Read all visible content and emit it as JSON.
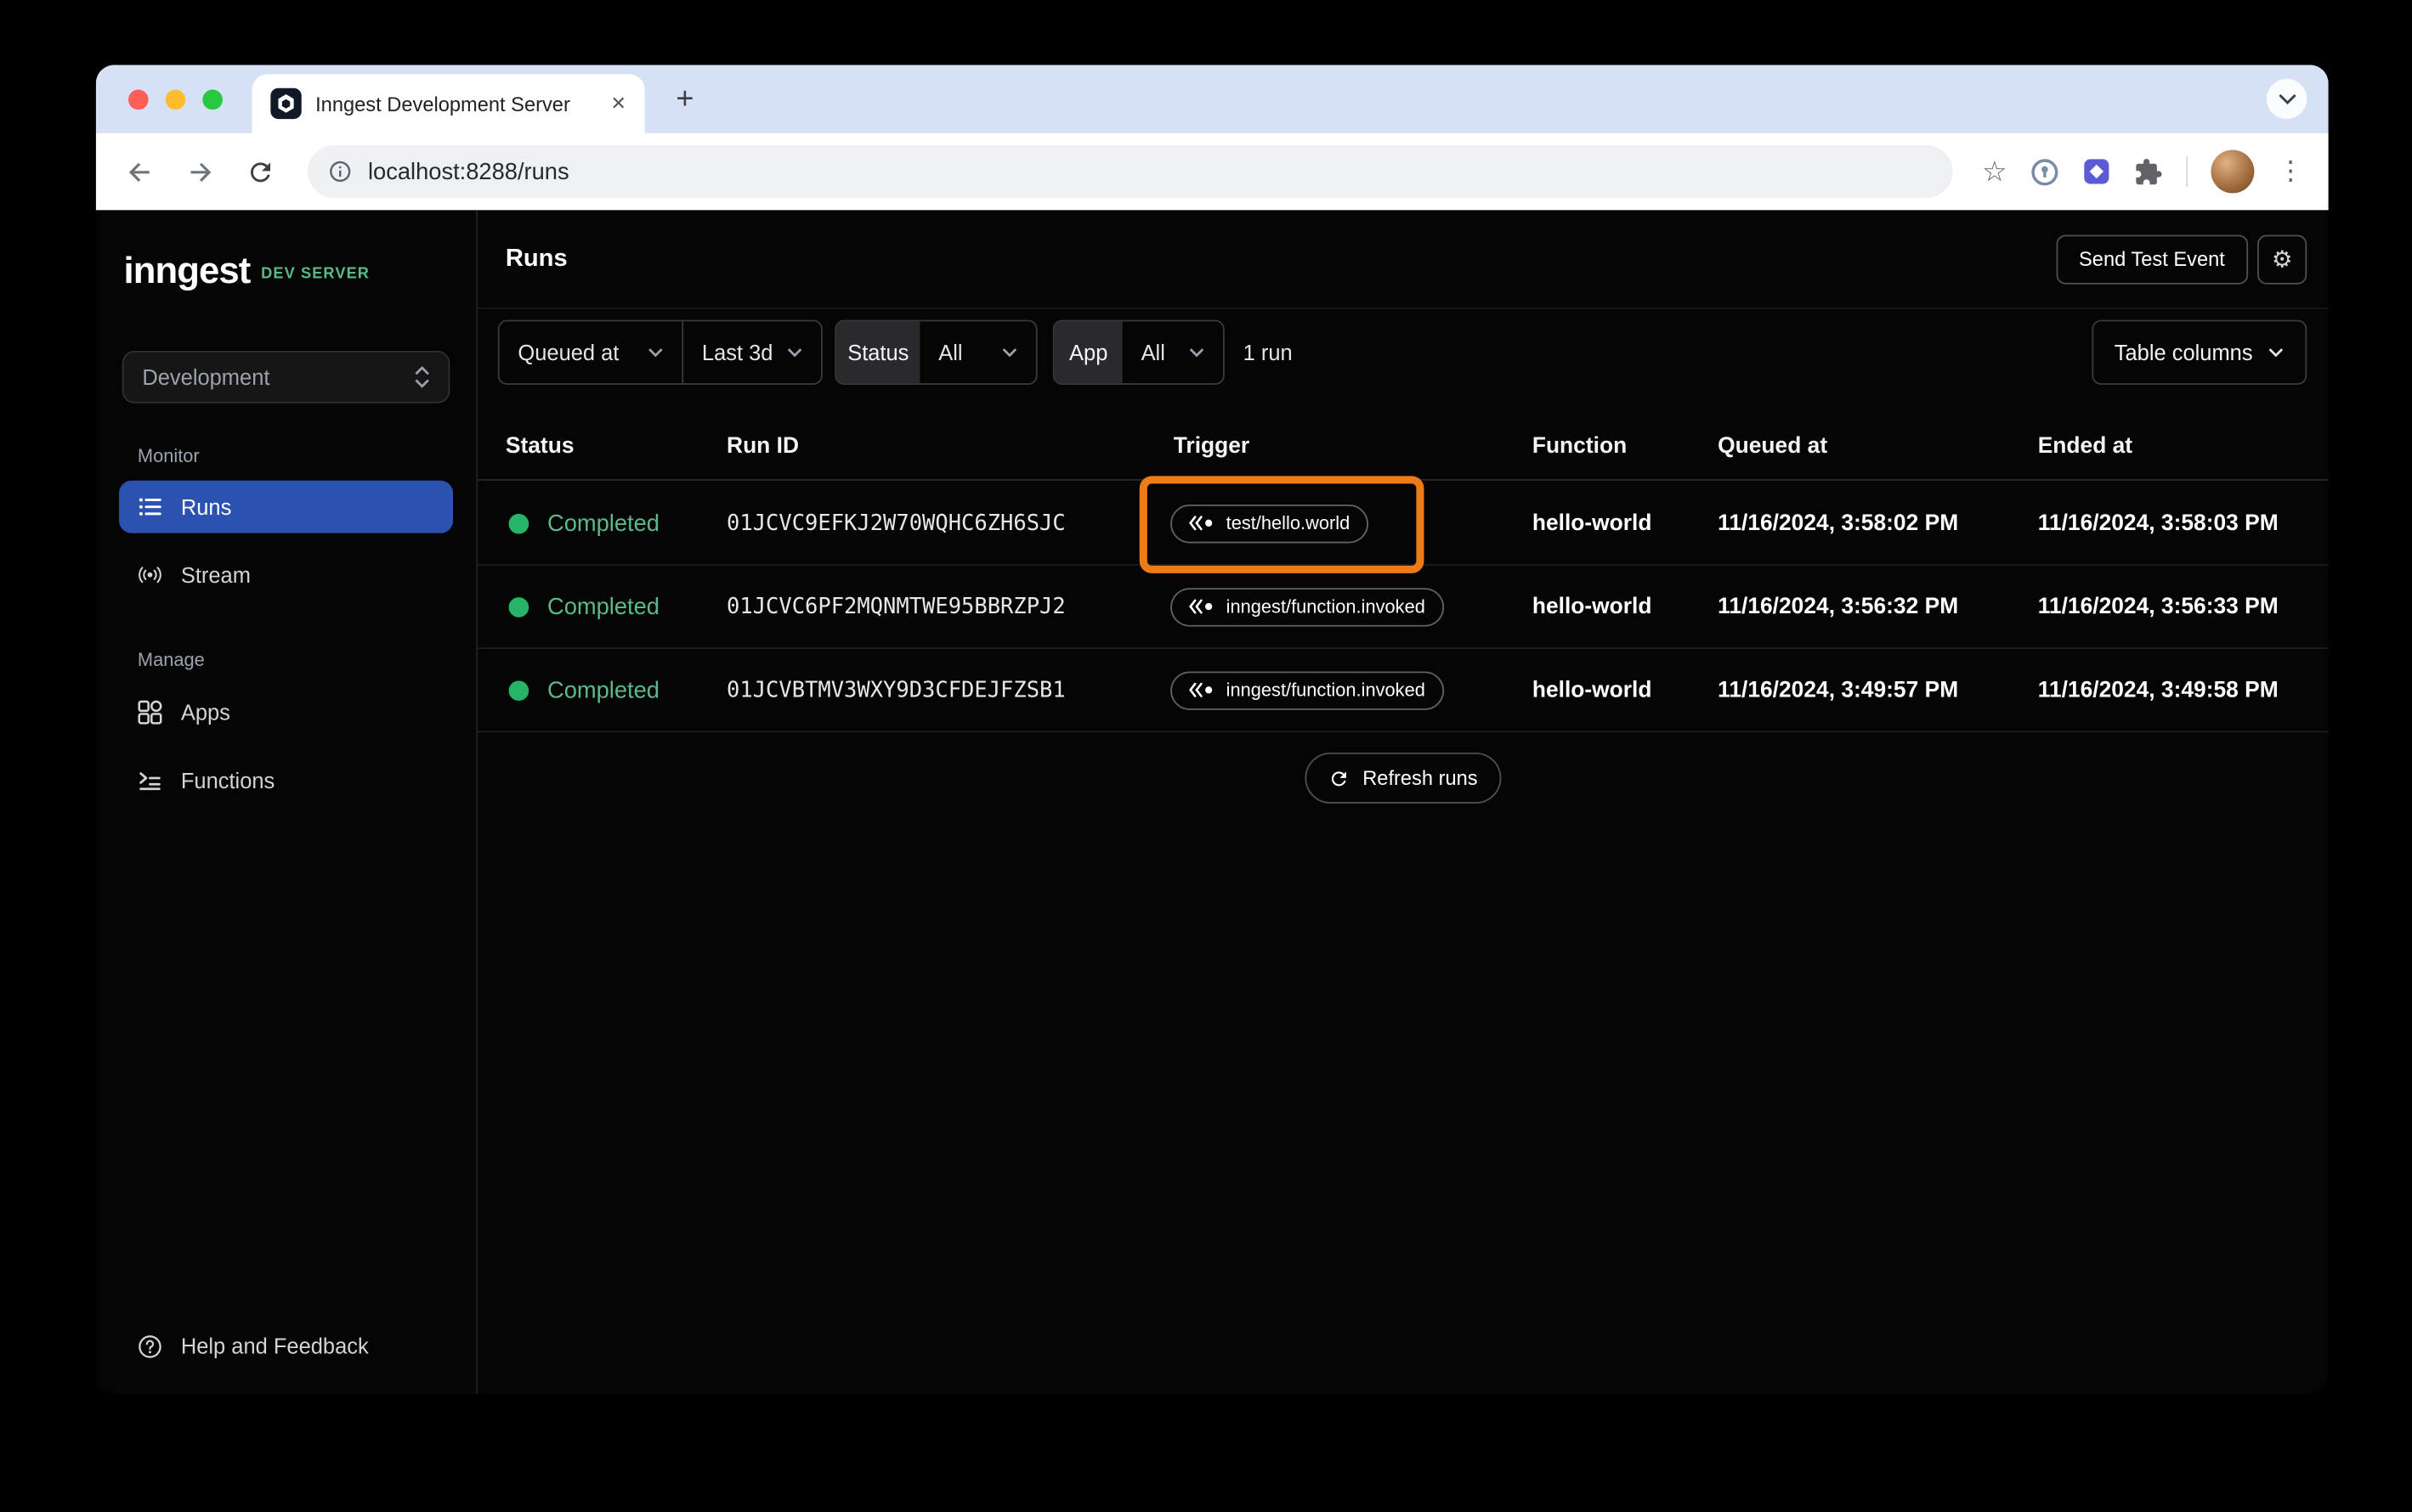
{
  "browser": {
    "tab_title": "Inngest Development Server",
    "url": "localhost:8288/runs"
  },
  "icons": {
    "close": "✕",
    "plus": "+",
    "star": "☆",
    "gear": "⚙",
    "menu": "⋮"
  },
  "sidebar": {
    "logo": "inngest",
    "badge": "DEV SERVER",
    "environment": "Development",
    "monitor_label": "Monitor",
    "manage_label": "Manage",
    "items": {
      "runs": "Runs",
      "stream": "Stream",
      "apps": "Apps",
      "functions": "Functions"
    },
    "help": "Help and Feedback"
  },
  "header": {
    "title": "Runs",
    "send_test_event": "Send Test Event"
  },
  "filters": {
    "queued_at": "Queued at",
    "time_range": "Last 3d",
    "status_label": "Status",
    "status_value": "All",
    "app_label": "App",
    "app_value": "All",
    "run_count": "1 run",
    "table_columns": "Table columns"
  },
  "table": {
    "columns": [
      "Status",
      "Run ID",
      "Trigger",
      "Function",
      "Queued at",
      "Ended at"
    ],
    "rows": [
      {
        "status": "Completed",
        "run_id": "01JCVC9EFKJ2W70WQHC6ZH6SJC",
        "trigger": "test/hello.world",
        "function": "hello-world",
        "queued_at": "11/16/2024, 3:58:02 PM",
        "ended_at": "11/16/2024, 3:58:03 PM",
        "highlighted": true
      },
      {
        "status": "Completed",
        "run_id": "01JCVC6PF2MQNMTWE95BBRZPJ2",
        "trigger": "inngest/function.invoked",
        "function": "hello-world",
        "queued_at": "11/16/2024, 3:56:32 PM",
        "ended_at": "11/16/2024, 3:56:33 PM",
        "highlighted": false
      },
      {
        "status": "Completed",
        "run_id": "01JCVBTMV3WXY9D3CFDEJFZSB1",
        "trigger": "inngest/function.invoked",
        "function": "hello-world",
        "queued_at": "11/16/2024, 3:49:57 PM",
        "ended_at": "11/16/2024, 3:49:58 PM",
        "highlighted": false
      }
    ],
    "refresh": "Refresh runs"
  },
  "colors": {
    "accent_blue": "#2b52b0",
    "success_green": "#5cb98a",
    "status_dot_green": "#27b368",
    "annotation_orange": "#ed7b17",
    "tabstrip_blue": "#d7e1f6"
  }
}
